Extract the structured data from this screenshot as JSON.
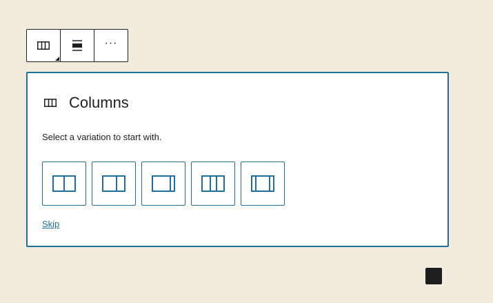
{
  "toolbar": {
    "buttons": [
      {
        "icon": "columns-icon",
        "label": "Columns"
      },
      {
        "icon": "align-icon",
        "label": "Align"
      },
      {
        "icon": "more-options-icon",
        "label": "Options"
      }
    ],
    "more_glyph": "···"
  },
  "placeholder": {
    "title": "Columns",
    "instructions": "Select a variation to start with.",
    "variations": [
      {
        "icon": "two-columns-equal-icon"
      },
      {
        "icon": "two-columns-wide-left-icon"
      },
      {
        "icon": "two-columns-wide-right-icon"
      },
      {
        "icon": "three-columns-equal-icon"
      },
      {
        "icon": "three-columns-wide-center-icon"
      }
    ],
    "skip_label": "Skip"
  },
  "colors": {
    "background": "#f3ebdd",
    "accent": "#1e6f9b",
    "text": "#1e1e1e"
  }
}
